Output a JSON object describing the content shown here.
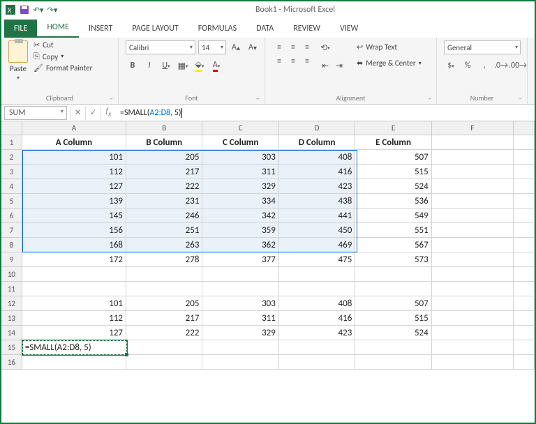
{
  "app_title": "Book1 - Microsoft Excel",
  "tabs": {
    "file": "FILE",
    "home": "HOME",
    "insert": "INSERT",
    "page_layout": "PAGE LAYOUT",
    "formulas": "FORMULAS",
    "data": "DATA",
    "review": "REVIEW",
    "view": "VIEW"
  },
  "clipboard": {
    "paste": "Paste",
    "cut": "Cut",
    "copy": "Copy",
    "format_painter": "Format Painter",
    "label": "Clipboard"
  },
  "font": {
    "name": "Calibri",
    "size": "14",
    "label": "Font"
  },
  "alignment": {
    "wrap": "Wrap Text",
    "merge": "Merge & Center",
    "label": "Alignment"
  },
  "number": {
    "format": "General",
    "label": "Number"
  },
  "namebox": "SUM",
  "formula_display_prefix": "=SMALL(",
  "formula_display_ref": "A2:D8",
  "formula_display_suffix": ", 5)",
  "active_cell_text": "=SMALL(A2:D8, 5)",
  "columns": [
    "A",
    "B",
    "C",
    "D",
    "E",
    "F"
  ],
  "headers": [
    "A Column",
    "B Column",
    "C Column",
    "D Column",
    "E Column"
  ],
  "row_nums": [
    "1",
    "2",
    "3",
    "4",
    "5",
    "6",
    "7",
    "8",
    "9",
    "10",
    "11",
    "12",
    "13",
    "14",
    "15",
    "16"
  ],
  "d": {
    "2": [
      "101",
      "205",
      "303",
      "408",
      "507"
    ],
    "3": [
      "112",
      "217",
      "311",
      "416",
      "515"
    ],
    "4": [
      "127",
      "222",
      "329",
      "423",
      "524"
    ],
    "5": [
      "139",
      "231",
      "334",
      "438",
      "536"
    ],
    "6": [
      "145",
      "246",
      "342",
      "441",
      "549"
    ],
    "7": [
      "156",
      "251",
      "359",
      "450",
      "551"
    ],
    "8": [
      "168",
      "263",
      "362",
      "469",
      "567"
    ],
    "9": [
      "172",
      "278",
      "377",
      "475",
      "573"
    ],
    "12": [
      "101",
      "205",
      "303",
      "408",
      "507"
    ],
    "13": [
      "112",
      "217",
      "311",
      "416",
      "515"
    ],
    "14": [
      "127",
      "222",
      "329",
      "423",
      "524"
    ]
  },
  "chart_data": {
    "type": "table",
    "title": "Spreadsheet data A2:E9",
    "columns": [
      "A Column",
      "B Column",
      "C Column",
      "D Column",
      "E Column"
    ],
    "rows": [
      [
        101,
        205,
        303,
        408,
        507
      ],
      [
        112,
        217,
        311,
        416,
        515
      ],
      [
        127,
        222,
        329,
        423,
        524
      ],
      [
        139,
        231,
        334,
        438,
        536
      ],
      [
        145,
        246,
        342,
        441,
        549
      ],
      [
        156,
        251,
        359,
        450,
        551
      ],
      [
        168,
        263,
        362,
        469,
        567
      ],
      [
        172,
        278,
        377,
        475,
        573
      ]
    ]
  }
}
